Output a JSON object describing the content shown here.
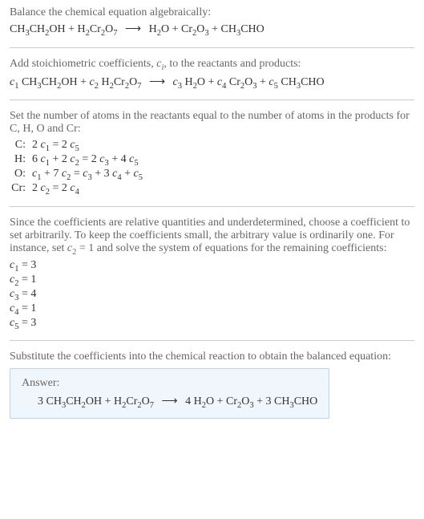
{
  "section1": {
    "prompt": "Balance the chemical equation algebraically:",
    "lhs1": "CH",
    "lhs1s": "3",
    "lhs2": "CH",
    "lhs2s": "2",
    "lhs3": "OH + H",
    "lhs3s": "2",
    "lhs4": "Cr",
    "lhs4s": "2",
    "lhs5": "O",
    "lhs5s": "7",
    "arrow": "⟶",
    "rhs1": "H",
    "rhs1s": "2",
    "rhs2": "O + Cr",
    "rhs2s": "2",
    "rhs3": "O",
    "rhs3s": "3",
    "rhs4": " + CH",
    "rhs4s": "3",
    "rhs5": "CHO"
  },
  "section2": {
    "prompt_a": "Add stoichiometric coefficients, ",
    "prompt_ci": "c",
    "prompt_ci_sub": "i",
    "prompt_b": ", to the reactants and products:",
    "c1": "c",
    "c1s": "1",
    "sp1a": " CH",
    "sp1as": "3",
    "sp1b": "CH",
    "sp1bs": "2",
    "sp1c": "OH + ",
    "c2": "c",
    "c2s": "2",
    "sp2a": " H",
    "sp2as": "2",
    "sp2b": "Cr",
    "sp2bs": "2",
    "sp2c": "O",
    "sp2cs": "7",
    "arrow": "⟶",
    "c3": "c",
    "c3s": "3",
    "sp3a": " H",
    "sp3as": "2",
    "sp3b": "O + ",
    "c4": "c",
    "c4s": "4",
    "sp4a": " Cr",
    "sp4as": "2",
    "sp4b": "O",
    "sp4bs": "3",
    "sp4c": " + ",
    "c5": "c",
    "c5s": "5",
    "sp5a": " CH",
    "sp5as": "3",
    "sp5b": "CHO"
  },
  "section3": {
    "prompt": "Set the number of atoms in the reactants equal to the number of atoms in the products for C, H, O and Cr:",
    "rows": [
      {
        "label": "C:",
        "eq_parts": [
          "2 ",
          "c",
          "1",
          " = 2 ",
          "c",
          "5"
        ]
      },
      {
        "label": "H:",
        "eq_parts": [
          "6 ",
          "c",
          "1",
          " + 2 ",
          "c",
          "2",
          " = 2 ",
          "c",
          "3",
          " + 4 ",
          "c",
          "5"
        ]
      },
      {
        "label": "O:",
        "eq_parts": [
          "",
          "c",
          "1",
          " + 7 ",
          "c",
          "2",
          " = ",
          "c",
          "3",
          " + 3 ",
          "c",
          "4",
          " + ",
          "c",
          "5"
        ]
      },
      {
        "label": "Cr:",
        "eq_parts": [
          "2 ",
          "c",
          "2",
          " = 2 ",
          "c",
          "4"
        ]
      }
    ]
  },
  "section4": {
    "prompt_a": "Since the coefficients are relative quantities and underdetermined, choose a coefficient to set arbitrarily. To keep the coefficients small, the arbitrary value is ordinarily one. For instance, set ",
    "prompt_c": "c",
    "prompt_c_sub": "2",
    "prompt_b": " = 1 and solve the system of equations for the remaining coefficients:",
    "coeffs": [
      {
        "c": "c",
        "s": "1",
        "v": " = 3"
      },
      {
        "c": "c",
        "s": "2",
        "v": " = 1"
      },
      {
        "c": "c",
        "s": "3",
        "v": " = 4"
      },
      {
        "c": "c",
        "s": "4",
        "v": " = 1"
      },
      {
        "c": "c",
        "s": "5",
        "v": " = 3"
      }
    ]
  },
  "section5": {
    "prompt": "Substitute the coefficients into the chemical reaction to obtain the balanced equation:"
  },
  "answer": {
    "label": "Answer:",
    "p1": "3 CH",
    "p1s": "3",
    "p2": "CH",
    "p2s": "2",
    "p3": "OH + H",
    "p3s": "2",
    "p4": "Cr",
    "p4s": "2",
    "p5": "O",
    "p5s": "7",
    "arrow": "⟶",
    "p6": "4 H",
    "p6s": "2",
    "p7": "O + Cr",
    "p7s": "2",
    "p8": "O",
    "p8s": "3",
    "p9": " + 3 CH",
    "p9s": "3",
    "p10": "CHO"
  },
  "chart_data": {
    "type": "table",
    "title": "Balanced chemical equation stoichiometric coefficients",
    "reaction_unbalanced": "CH3CH2OH + H2Cr2O7 -> H2O + Cr2O3 + CH3CHO",
    "atom_balance_equations": {
      "C": "2 c1 = 2 c5",
      "H": "6 c1 + 2 c2 = 2 c3 + 4 c5",
      "O": "c1 + 7 c2 = c3 + 3 c4 + c5",
      "Cr": "2 c2 = 2 c4"
    },
    "coefficients": {
      "c1": 3,
      "c2": 1,
      "c3": 4,
      "c4": 1,
      "c5": 3
    },
    "reaction_balanced": "3 CH3CH2OH + H2Cr2O7 -> 4 H2O + Cr2O3 + 3 CH3CHO"
  }
}
